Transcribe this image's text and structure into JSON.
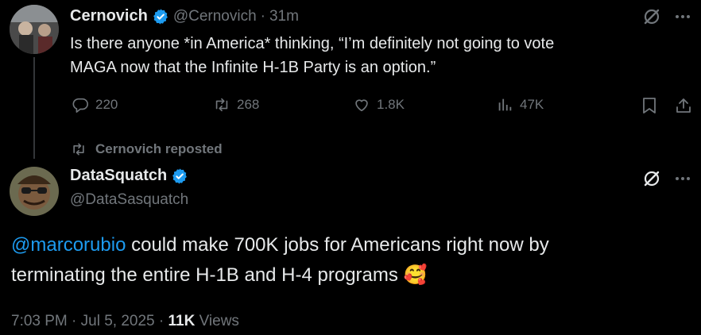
{
  "colors": {
    "background": "#000000",
    "text": "#e7e9ea",
    "muted": "#71767b",
    "link": "#1d9bf0",
    "verified": "#1d9bf0"
  },
  "first_tweet": {
    "display_name": "Cernovich",
    "handle": "@Cernovich",
    "separator": "·",
    "time_ago": "31m",
    "text_line1": "Is there anyone *in America* thinking, “I’m definitely not going to vote",
    "text_line2": "MAGA now that the Infinite H-1B Party is an option.”",
    "replies": "220",
    "reposts": "268",
    "likes": "1.8K",
    "views": "47K"
  },
  "repost_note": {
    "text": "Cernovich reposted"
  },
  "second_tweet": {
    "display_name": "DataSquatch",
    "handle": "@DataSasquatch",
    "mention": "@marcorubio",
    "text_line1_rest": " could make 700K jobs for Americans right now by",
    "text_line2": "terminating the entire H-1B and H-4 programs ",
    "emoji": "🥰",
    "timestamp": "7:03 PM · Jul 5, 2025 · ",
    "views_count": "11K",
    "views_label": " Views"
  }
}
